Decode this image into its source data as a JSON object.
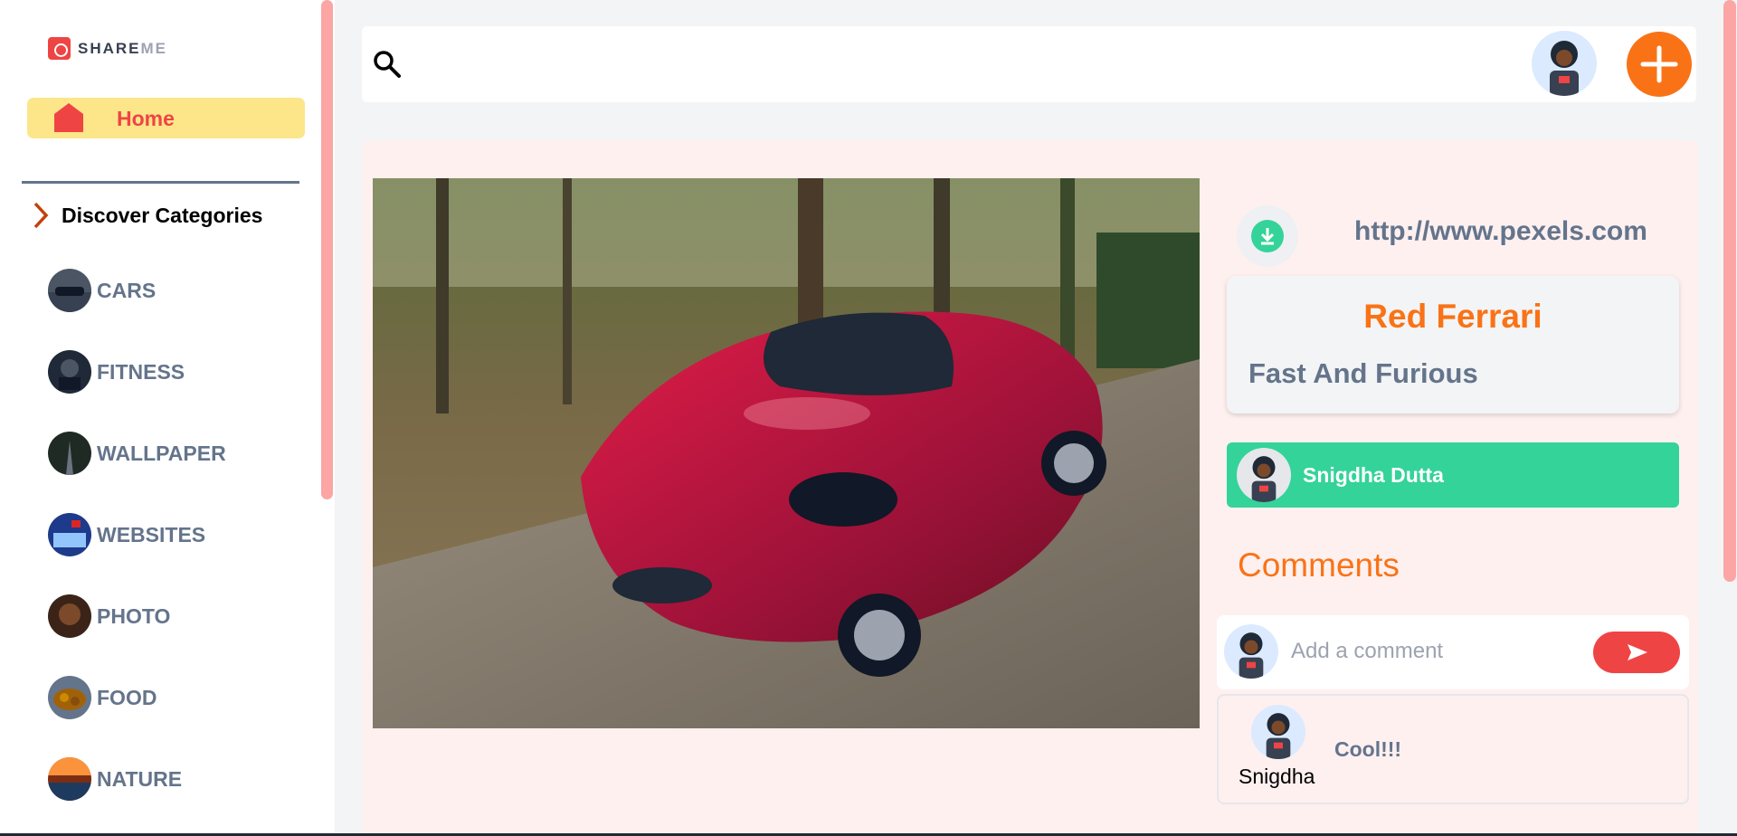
{
  "app": {
    "logo_text_main": "SHARE",
    "logo_text_accent": "ME"
  },
  "sidebar": {
    "home_label": "Home",
    "discover_label": "Discover Categories",
    "categories": [
      {
        "label": "CARS",
        "icon": "cars-thumbnail"
      },
      {
        "label": "FITNESS",
        "icon": "fitness-thumbnail"
      },
      {
        "label": "WALLPAPER",
        "icon": "wallpaper-thumbnail"
      },
      {
        "label": "WEBSITES",
        "icon": "websites-thumbnail"
      },
      {
        "label": "PHOTO",
        "icon": "photo-thumbnail"
      },
      {
        "label": "FOOD",
        "icon": "food-thumbnail"
      },
      {
        "label": "NATURE",
        "icon": "nature-thumbnail"
      }
    ]
  },
  "topbar": {
    "search_placeholder": ""
  },
  "pin": {
    "destination": "http://www.pexels.com",
    "title": "Red Ferrari",
    "about": "Fast And Furious",
    "posted_by": "Snigdha Dutta"
  },
  "comments": {
    "heading": "Comments",
    "input_placeholder": "Add a comment",
    "items": [
      {
        "author": "Snigdha",
        "text": "Cool!!!"
      }
    ]
  },
  "colors": {
    "accent_orange": "#f97316",
    "accent_red": "#ef4444",
    "accent_green": "#34d399",
    "home_bg": "#fde68a",
    "panel_bg": "#fff0f0"
  }
}
